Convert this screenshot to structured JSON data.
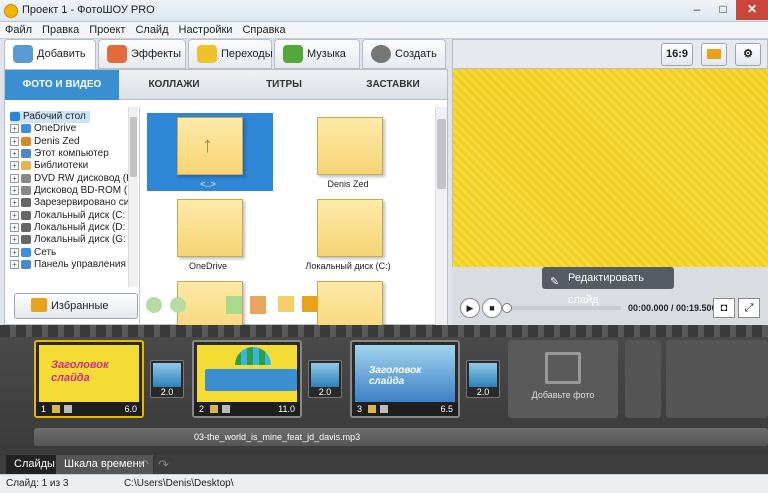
{
  "window": {
    "title": "Проект 1 - ФотоШОУ PRO",
    "min": "–",
    "max": "□",
    "close": "✕"
  },
  "menu": [
    "Файл",
    "Правка",
    "Проект",
    "Слайд",
    "Настройки",
    "Справка"
  ],
  "tabs": [
    "Добавить",
    "Эффекты",
    "Переходы",
    "Музыка",
    "Создать"
  ],
  "toolbar_right": {
    "ratio": "16:9"
  },
  "subtabs": [
    "ФОТО И ВИДЕО",
    "КОЛЛАЖИ",
    "ТИТРЫ",
    "ЗАСТАВКИ"
  ],
  "tree": [
    {
      "label": "Рабочий стол",
      "pm": "",
      "color": "#2f86d6"
    },
    {
      "label": "OneDrive",
      "pm": "+",
      "color": "#3b8fe0"
    },
    {
      "label": "Denis Zed",
      "pm": "+",
      "color": "#d68a2f"
    },
    {
      "label": "Этот компьютер",
      "pm": "+",
      "color": "#4a88c8"
    },
    {
      "label": "Библиотеки",
      "pm": "+",
      "color": "#e0b74a"
    },
    {
      "label": "DVD RW дисковод (H",
      "pm": "+",
      "color": "#888"
    },
    {
      "label": "Дисковод BD-ROM (E",
      "pm": "+",
      "color": "#888"
    },
    {
      "label": "Зарезервировано си",
      "pm": "+",
      "color": "#666"
    },
    {
      "label": "Локальный диск (C:",
      "pm": "+",
      "color": "#666"
    },
    {
      "label": "Локальный диск (D:",
      "pm": "+",
      "color": "#666"
    },
    {
      "label": "Локальный диск (G:",
      "pm": "+",
      "color": "#666"
    },
    {
      "label": "Сеть",
      "pm": "+",
      "color": "#3b8fe0"
    },
    {
      "label": "Панель управления",
      "pm": "+",
      "color": "#4a88c8"
    }
  ],
  "files": [
    {
      "label": "<..>",
      "selected": true
    },
    {
      "label": "Denis Zed",
      "selected": false
    },
    {
      "label": "OneDrive",
      "selected": false
    },
    {
      "label": "Локальный диск (C:)",
      "selected": false
    }
  ],
  "fav_button": "Избранные папки",
  "preview": {
    "edit_button": "Редактировать слайд",
    "time": "00:00.000 / 00:19.500",
    "progress": 0
  },
  "slides": [
    {
      "num": "1",
      "duration": "6.0",
      "title": "Заголовок слайда"
    },
    {
      "num": "2",
      "duration": "11.0",
      "title": ""
    },
    {
      "num": "3",
      "duration": "6.5",
      "title": "Заголовок слайда"
    }
  ],
  "transitions": [
    "2.0",
    "2.0",
    "2.0"
  ],
  "add_photo": "Добавьте фото",
  "audio_track": "03-the_world_is_mine_feat_jd_davis.mp3",
  "bottom_tabs": [
    "Слайды",
    "Шкала времени"
  ],
  "status": {
    "slide": "Слайд: 1 из 3",
    "path": "C:\\Users\\Denis\\Desktop\\"
  }
}
